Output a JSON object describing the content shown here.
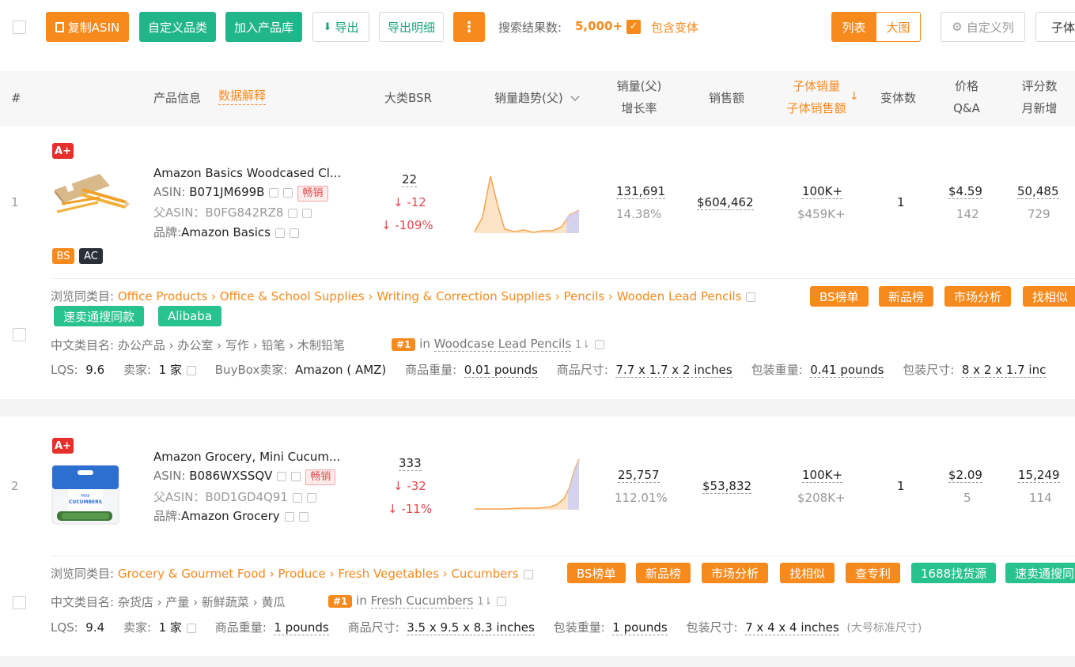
{
  "toolbar": {
    "copy_asin": "复制ASIN",
    "custom_category": "自定义品类",
    "add_library": "加入产品库",
    "export": "导出",
    "export_detail": "导出明细",
    "more": "⋮",
    "result_label": "搜索结果数:",
    "result_count": "5,000+",
    "include_variants": "包含变体",
    "view_list": "列表",
    "view_grid": "大图",
    "custom_columns": "自定义列",
    "child": "子体"
  },
  "header": {
    "index": "#",
    "product_info": "产品信息",
    "data_explain": "数据解释",
    "bsr": "大类BSR",
    "trend": "销量趋势(父)",
    "sales": "销量(父)",
    "growth": "增长率",
    "revenue": "销售额",
    "child_sales": "子体销量",
    "child_revenue": "子体销售额",
    "variants": "变体数",
    "price": "价格",
    "qa": "Q&A",
    "ratings": "评分数",
    "monthly_new": "月新增"
  },
  "rows": [
    {
      "index": "1",
      "aplus": "A+",
      "title": "Amazon Basics Woodcased Cl...",
      "asin_label": "ASIN:",
      "asin": "B071JM699B",
      "hot": "畅销",
      "parent_asin": "父ASIN：B0FG842RZ8",
      "brand_label": "品牌:",
      "brand": "Amazon Basics",
      "badge_bs": "BS",
      "badge_ac": "AC",
      "bsr": "22",
      "bsr_change": "-12",
      "bsr_pct": "-109%",
      "sales": "131,691",
      "growth": "14.38%",
      "revenue": "$604,462",
      "child_sales": "100K+",
      "child_revenue": "$459K+",
      "variants": "1",
      "price": "$4.59",
      "qa": "142",
      "ratings": "50,485",
      "monthly_new": "729",
      "browse_label": "浏览同类目:",
      "browse_path": [
        "Office Products",
        "Office & School Supplies",
        "Writing & Correction Supplies",
        "Pencils",
        "Wooden Lead Pencils"
      ],
      "actions": [
        "BS榜单",
        "新品榜",
        "市场分析",
        "找相似"
      ],
      "actions_green": [
        "速卖通搜同款",
        "Alibaba"
      ],
      "cn_label": "中文类目名:",
      "cn_path": "办公产品 › 办公室 › 写作 › 铅笔 › 木制铅笔",
      "rank": "#1",
      "rank_in": "in",
      "rank_cat": "Woodcase Lead Pencils",
      "lqs_label": "LQS:",
      "lqs": "9.6",
      "sellers_label": "卖家:",
      "sellers": "1 家",
      "buybox_label": "BuyBox卖家:",
      "buybox": "Amazon ( AMZ)",
      "weight_label": "商品重量:",
      "weight": "0.01 pounds",
      "size_label": "商品尺寸:",
      "size": "7.7 x 1.7 x 2 inches",
      "pkg_weight_label": "包装重量:",
      "pkg_weight": "0.41 pounds",
      "pkg_size_label": "包装尺寸:",
      "pkg_size": "8 x 2 x 1.7 inc"
    },
    {
      "index": "2",
      "aplus": "A+",
      "title": "Amazon Grocery, Mini Cucum...",
      "asin_label": "ASIN:",
      "asin": "B086WXSSQV",
      "hot": "畅销",
      "parent_asin": "父ASIN：B0D1GD4Q91",
      "brand_label": "品牌:",
      "brand": "Amazon Grocery",
      "bsr": "333",
      "bsr_change": "-32",
      "bsr_pct": "-11%",
      "sales": "25,757",
      "growth": "112.01%",
      "revenue": "$53,832",
      "child_sales": "100K+",
      "child_revenue": "$208K+",
      "variants": "1",
      "price": "$2.09",
      "qa": "5",
      "ratings": "15,249",
      "monthly_new": "114",
      "browse_label": "浏览同类目:",
      "browse_path": [
        "Grocery & Gourmet Food",
        "Produce",
        "Fresh Vegetables",
        "Cucumbers"
      ],
      "actions": [
        "BS榜单",
        "新品榜",
        "市场分析",
        "找相似",
        "查专利"
      ],
      "actions_green": [
        "1688找货源",
        "速卖通搜同"
      ],
      "cn_label": "中文类目名:",
      "cn_path": "杂货店 › 产量 › 新鲜蔬菜 › 黄瓜",
      "rank": "#1",
      "rank_in": "in",
      "rank_cat": "Fresh Cucumbers",
      "lqs_label": "LQS:",
      "lqs": "9.4",
      "sellers_label": "卖家:",
      "sellers": "1 家",
      "weight_label": "商品重量:",
      "weight": "1 pounds",
      "size_label": "商品尺寸:",
      "size": "3.5 x 9.5 x 8.3 inches",
      "pkg_weight_label": "包装重量:",
      "pkg_weight": "1 pounds",
      "pkg_size_label": "包装尺寸:",
      "pkg_size": "7 x 4 x 4 inches",
      "size_tier": "(大号标准尺寸)"
    }
  ],
  "image_labels": {
    "cucumbers_brand": "MINI",
    "cucumbers_name": "CUCUMBERS"
  },
  "colors": {
    "orange": "#f78a1d",
    "green": "#20b58a",
    "red": "#e5484d"
  }
}
